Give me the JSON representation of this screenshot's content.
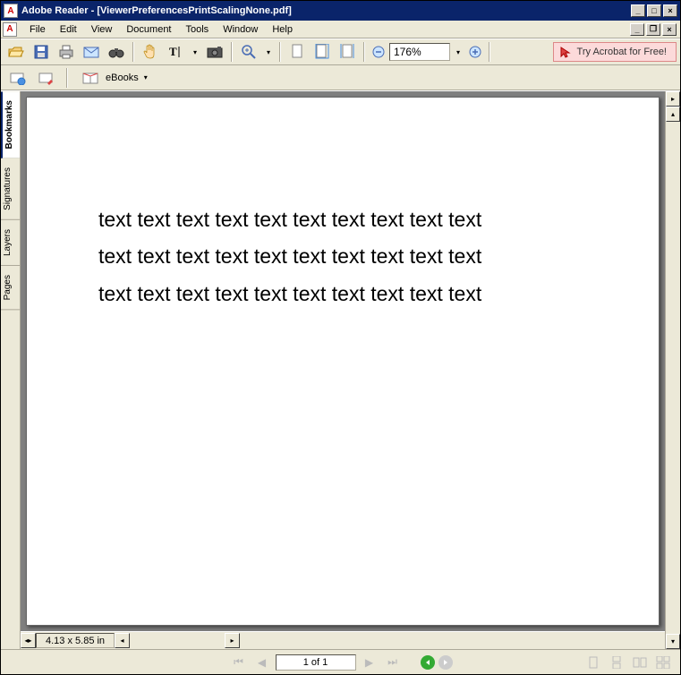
{
  "title": "Adobe Reader - [ViewerPreferencesPrintScalingNone.pdf]",
  "menu": [
    "File",
    "Edit",
    "View",
    "Document",
    "Tools",
    "Window",
    "Help"
  ],
  "toolbar": {
    "try_acrobat": "Try Acrobat for Free!",
    "zoom": "176%"
  },
  "toolbar2": {
    "ebooks": "eBooks"
  },
  "side_tabs": [
    "Bookmarks",
    "Signatures",
    "Layers",
    "Pages"
  ],
  "document": {
    "lines": [
      "text text text text text text text text text text",
      "text text text text text text text text text text",
      "text text text text text text text text text text"
    ]
  },
  "status": {
    "dimensions": "4.13 x 5.85 in"
  },
  "nav": {
    "page_label": "1 of 1"
  }
}
